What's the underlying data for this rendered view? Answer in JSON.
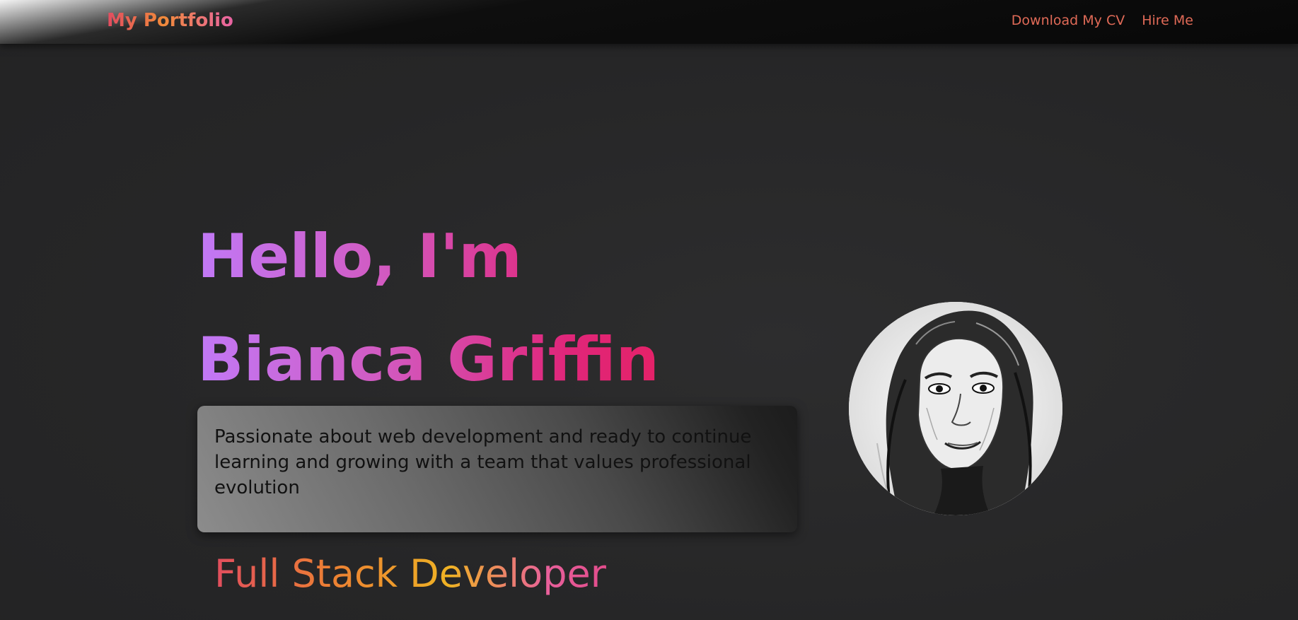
{
  "header": {
    "brand": "My Portfolio",
    "nav_links": [
      {
        "label": "Download My CV"
      },
      {
        "label": "Hire Me"
      }
    ]
  },
  "hero": {
    "greeting": "Hello, I'm",
    "name": "Bianca Griffin",
    "bio": "Passionate about web development and ready to continue learning and growing with a team that values professional evolution",
    "role": "Full Stack Developer"
  },
  "colors": {
    "background": "#2a2a2b",
    "name_gradient_start": "#c179f7",
    "name_gradient_end": "#e42268",
    "nav_link": "#e06a57",
    "role_gradient": [
      "#e24e5e",
      "#efb224",
      "#e24c8c"
    ]
  },
  "avatar": {
    "icon": "profile-photo-portrait"
  }
}
